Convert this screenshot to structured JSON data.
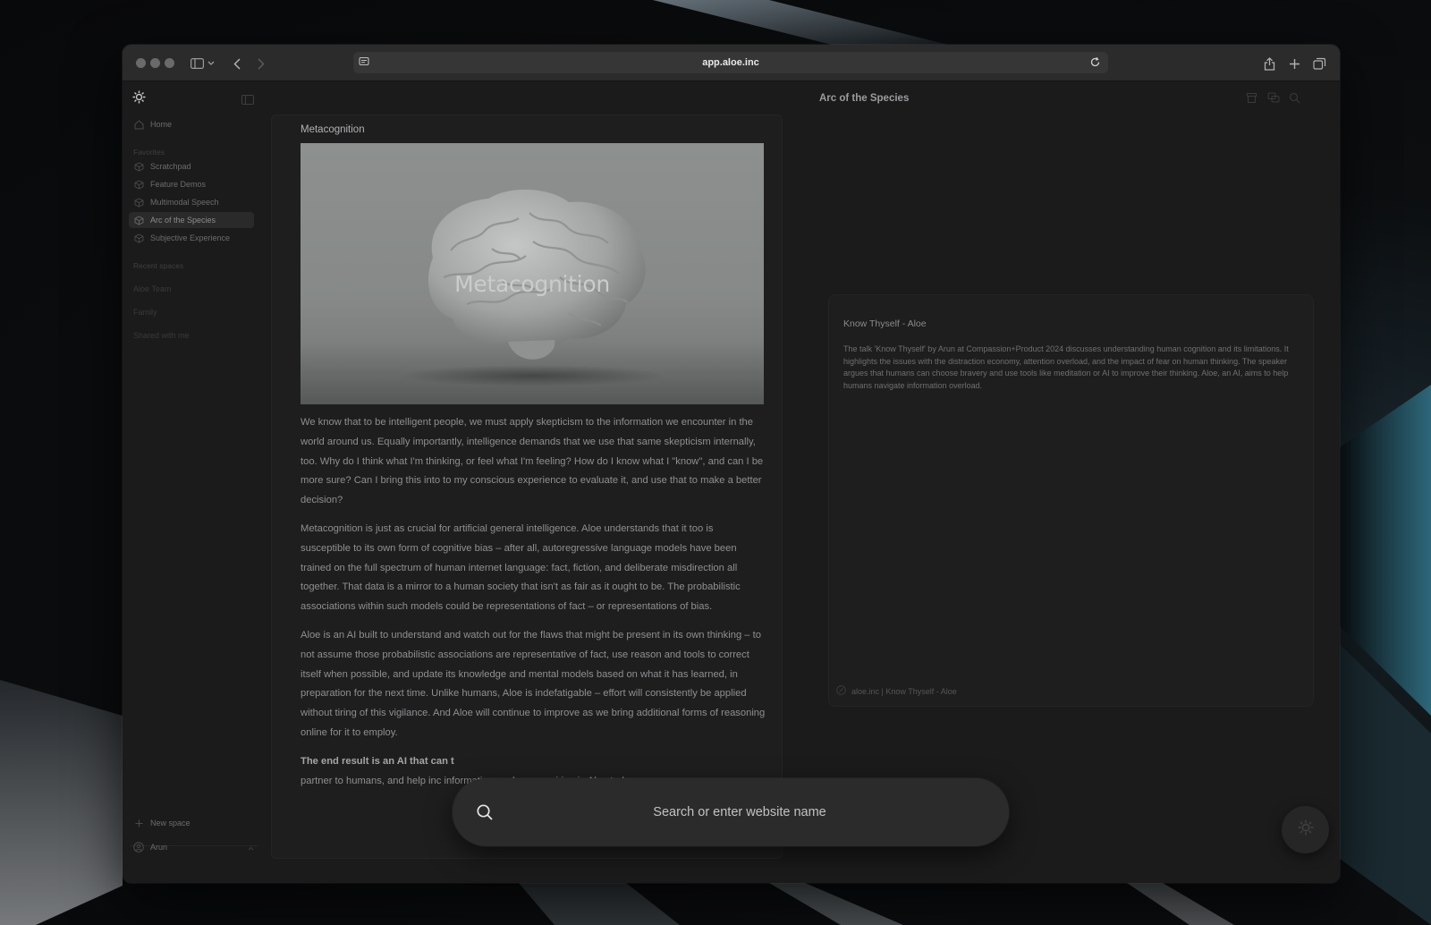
{
  "browser": {
    "url": "app.aloe.inc"
  },
  "sidebar": {
    "home_label": "Home",
    "favorites_heading": "Favorites",
    "favorites": [
      {
        "label": "Scratchpad"
      },
      {
        "label": "Feature Demos"
      },
      {
        "label": "Multimodal Speech"
      },
      {
        "label": "Arc of the Species",
        "active": true
      },
      {
        "label": "Subjective Experience"
      }
    ],
    "recent_heading": "Recent spaces",
    "recent": [
      {
        "label": "Aloe Team"
      },
      {
        "label": "Family"
      },
      {
        "label": "Shared with me"
      }
    ],
    "new_space_label": "New space",
    "user_name": "Arun"
  },
  "document": {
    "title": "Metacognition",
    "image_caption": "Metacognition",
    "paragraphs": [
      "We know that to be intelligent people, we must apply skepticism to the information we encounter in the world around us. Equally importantly, intelligence demands that we use that same skepticism internally, too. Why do I think what I'm thinking, or feel what I'm feeling? How do I know what I \"know\", and can I be more sure? Can I bring this into to my conscious experience to evaluate it, and use that to make a better decision?",
      "Metacognition is just as crucial for artificial general intelligence. Aloe understands that it too is susceptible to its own form of cognitive bias – after all, autoregressive language models have been trained on the full spectrum of human internet language: fact, fiction, and deliberate misdirection all together. That data is a mirror to a human society that isn't as fair as it ought to be. The probabilistic associations within such models could be representations of fact – or representations of bias.",
      "Aloe is an AI built to understand and watch out for the flaws that might be present in its own thinking – to not assume those probabilistic associations are representative of fact, use reason and tools to correct itself when possible, and update its knowledge and mental models based on what it has learned, in preparation for the next time. Unlike humans, Aloe is indefatigable – effort will consistently be applied without tiring of this vigilance. And Aloe will continue to improve as we bring additional forms of reasoning online for it to employ."
    ],
    "final_bold": "The end result is an AI that can t",
    "final_rest": "partner to humans, and help inc information pushes our wiring in Aloe today."
  },
  "right_pane": {
    "title": "Arc of the Species",
    "card": {
      "title": "Know Thyself - Aloe",
      "description": "The talk 'Know Thyself' by Arun at Compassion+Product 2024 discusses understanding human cognition and its limitations. It highlights the issues with the distraction economy, attention overload, and the impact of fear on human thinking. The speaker argues that humans can choose bravery and use tools like meditation or AI to improve their thinking. Aloe, an AI, aims to help humans navigate information overload.",
      "source": "aloe.inc | Know Thyself - Aloe"
    }
  },
  "search_overlay": {
    "placeholder": "Search or enter website name"
  }
}
